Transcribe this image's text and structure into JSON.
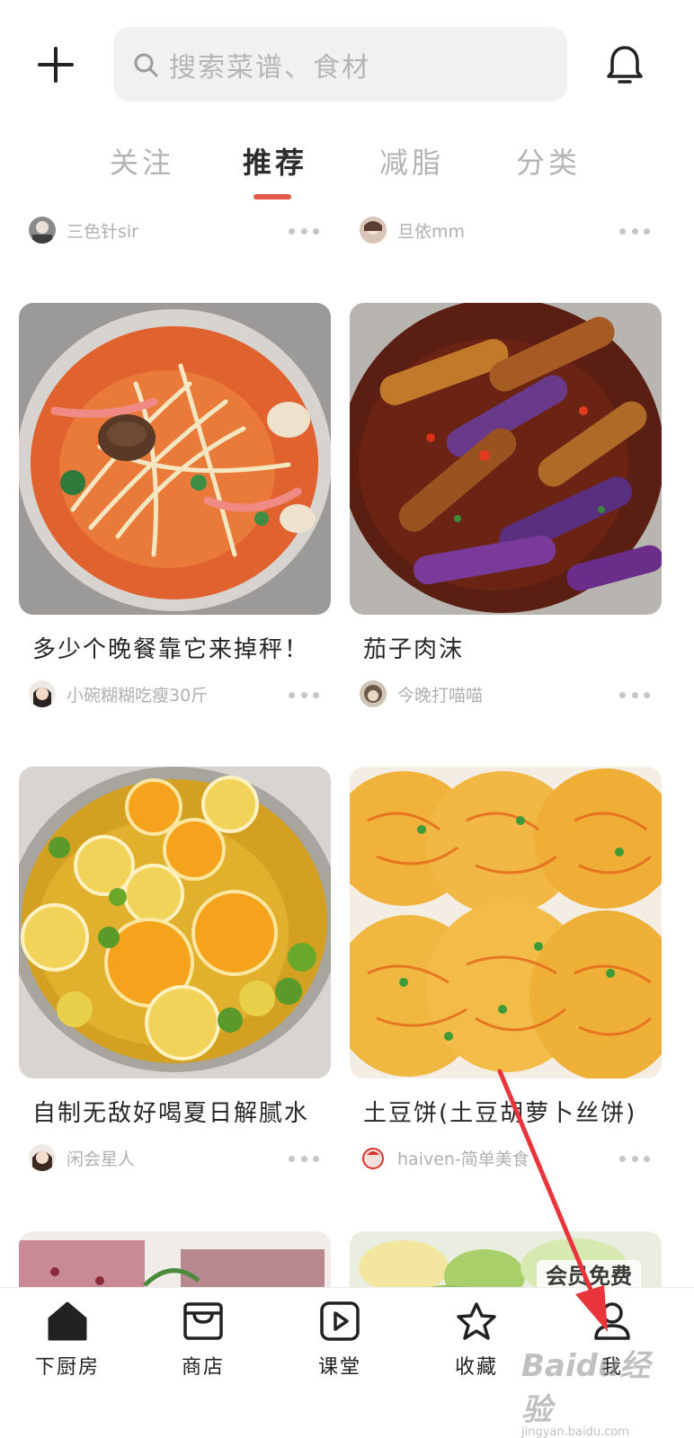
{
  "search": {
    "placeholder": "搜索菜谱、食材"
  },
  "tabs": [
    {
      "label": "关注"
    },
    {
      "label": "推荐"
    },
    {
      "label": "减脂"
    },
    {
      "label": "分类"
    }
  ],
  "active_tab": "推荐",
  "top_authors": [
    {
      "name": "三色针sir"
    },
    {
      "name": "旦依mm"
    }
  ],
  "cards": [
    {
      "title": "多少个晚餐靠它来掉秤！",
      "author": "小碗糊糊吃瘦30斤",
      "image": "tomato-enoki-soup"
    },
    {
      "title": "茄子肉沫",
      "author": "今晚打喵喵",
      "image": "braised-eggplant"
    },
    {
      "title": "自制无敌好喝夏日解腻水",
      "author": "闲会星人",
      "image": "lemon-drink"
    },
    {
      "title": "土豆饼(土豆胡萝卜丝饼)",
      "author": "haiven-简单美食",
      "image": "potato-pancakes"
    }
  ],
  "partial_card_badge": "会员免费",
  "bottom_nav": [
    {
      "label": "下厨房",
      "icon": "home-icon"
    },
    {
      "label": "商店",
      "icon": "store-icon"
    },
    {
      "label": "课堂",
      "icon": "play-icon"
    },
    {
      "label": "收藏",
      "icon": "star-icon"
    },
    {
      "label": "我",
      "icon": "user-icon"
    }
  ],
  "colors": {
    "accent": "#e35a4b",
    "annotation_arrow": "#e8343a"
  },
  "watermark": {
    "brand": "Baidu经验",
    "url": "jingyan.baidu.com"
  }
}
